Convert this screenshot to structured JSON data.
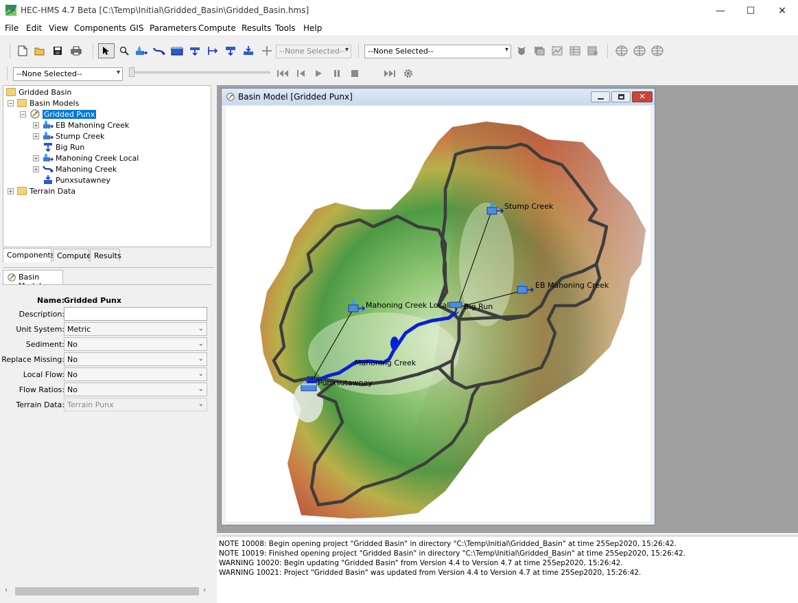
{
  "window": {
    "title": "HEC-HMS 4.7 Beta [C:\\Temp\\Initial\\Gridded_Basin\\Gridded_Basin.hms]",
    "minimize_glyph": "—",
    "maximize_glyph": "☐",
    "close_glyph": "✕"
  },
  "menu": [
    "File",
    "Edit",
    "View",
    "Components",
    "GIS",
    "Parameters",
    "Compute",
    "Results",
    "Tools",
    "Help"
  ],
  "toolbar": {
    "element_select": "--None Selected--",
    "run_select": "--None Selected--",
    "time_select": "--None Selected--"
  },
  "tree": {
    "root": "Gridded Basin",
    "basin_models": "Basin Models",
    "basin": "Gridded Punx",
    "elements": [
      "EB Mahoning Creek",
      "Stump Creek",
      "Big Run",
      "Mahoning Creek Local",
      "Mahoning Creek",
      "Punxsutawney"
    ],
    "terrain": "Terrain Data"
  },
  "left_tabs": [
    "Components",
    "Compute",
    "Results"
  ],
  "props": {
    "tab": "Basin Model",
    "name_label": "Name:",
    "name_value": "Gridded Punx",
    "fields": [
      {
        "label": "Description:",
        "value": ""
      },
      {
        "label": "Unit System:",
        "value": "Metric"
      },
      {
        "label": "Sediment:",
        "value": "No"
      },
      {
        "label": "Replace Missing:",
        "value": "No"
      },
      {
        "label": "Local Flow:",
        "value": "No"
      },
      {
        "label": "Flow Ratios:",
        "value": "No"
      },
      {
        "label": "Terrain Data:",
        "value": "Terrain Punx"
      }
    ]
  },
  "basin_window": {
    "title": "Basin Model [Gridded Punx]"
  },
  "map": {
    "labels": {
      "stump": "Stump Creek",
      "eb": "EB Mahoning Creek",
      "local": "Mahoning Creek Local",
      "bigrun": "Big Run",
      "mahoning": "Mahoning Creek",
      "punx": "Punxsutawney"
    }
  },
  "messages": [
    "NOTE 10008:  Begin opening project \"Gridded Basin\" in directory \"C:\\Temp\\Initial\\Gridded_Basin\" at time 25Sep2020, 15:26:42.",
    "NOTE 10019:  Finished opening project \"Gridded Basin\" in directory \"C:\\Temp\\Initial\\Gridded_Basin\" at time 25Sep2020, 15:26:42.",
    "WARNING 10020:  Begin updating \"Gridded Basin\" from Version 4.4 to Version 4.7 at time 25Sep2020, 15:26:42.",
    "WARNING 10021:  Project \"Gridded Basin\" was updated from Version 4.4 to Version 4.7 at time 25Sep2020, 15:26:42."
  ],
  "colors": {
    "selection": "#0078d7",
    "river": "#0a1fd6",
    "boundary": "#3b3b3b"
  }
}
